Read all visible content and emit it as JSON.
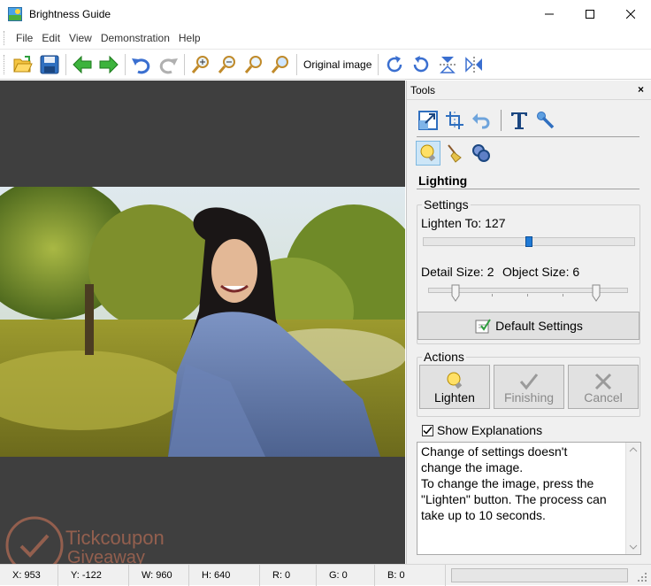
{
  "window": {
    "title": "Brightness Guide"
  },
  "menu": [
    "File",
    "Edit",
    "View",
    "Demonstration",
    "Help"
  ],
  "toolbar": {
    "original_image_label": "Original image"
  },
  "watermark": {
    "line1": "Tickcoupon",
    "line2": "Giveaway"
  },
  "tools": {
    "title": "Tools",
    "close": "×",
    "section_title": "Lighting",
    "settings": {
      "group_label": "Settings",
      "lighten_to_label": "Lighten To: 127",
      "lighten_to_value": 127,
      "detail_size_label": "Detail Size: 2",
      "object_size_label": "Object Size: 6",
      "default_button": "Default Settings"
    },
    "actions": {
      "group_label": "Actions",
      "lighten": "Lighten",
      "finishing": "Finishing",
      "cancel": "Cancel"
    },
    "show_explanations": {
      "label": "Show Explanations",
      "checked": true
    },
    "explanation_lines": [
      "Change of settings doesn't",
      "change the image.",
      "To change the image, press the",
      "\"Lighten\" button. The process can",
      "take up to 10 seconds."
    ]
  },
  "status": {
    "x": "X: 953",
    "y": "Y: -122",
    "w": "W: 960",
    "h": "H: 640",
    "r": "R: 0",
    "g": "G: 0",
    "b": "B: 0"
  }
}
